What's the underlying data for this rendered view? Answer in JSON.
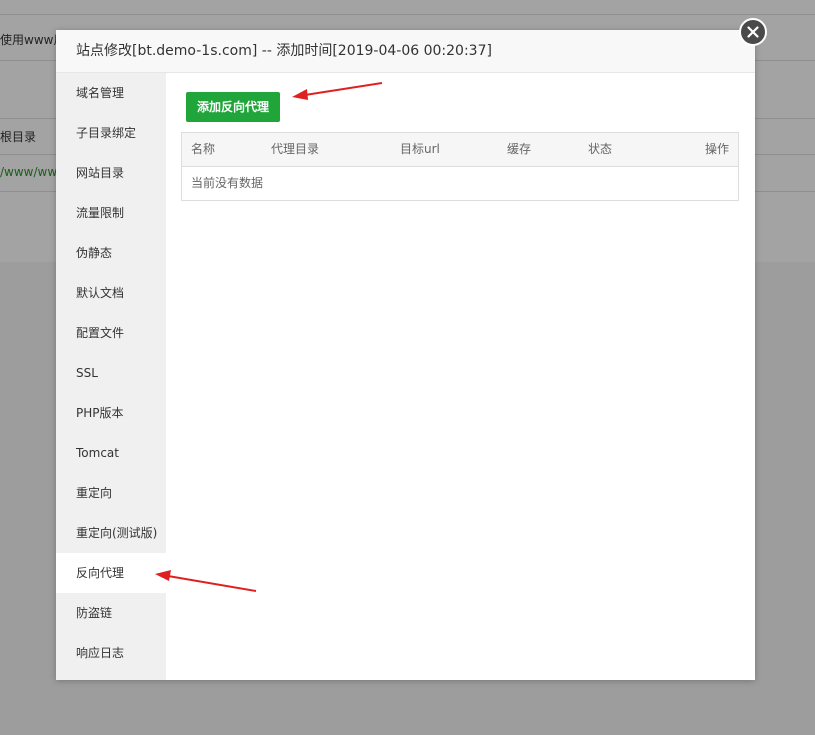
{
  "background": {
    "row1_text": "使用www用",
    "row2_text": "根目录",
    "row3_text": "/www/www"
  },
  "dialog": {
    "title": "站点修改[bt.demo-1s.com] -- 添加时间[2019-04-06 00:20:37]",
    "close_icon": "close-icon"
  },
  "sidebar": {
    "items": [
      {
        "label": "域名管理"
      },
      {
        "label": "子目录绑定"
      },
      {
        "label": "网站目录"
      },
      {
        "label": "流量限制"
      },
      {
        "label": "伪静态"
      },
      {
        "label": "默认文档"
      },
      {
        "label": "配置文件"
      },
      {
        "label": "SSL"
      },
      {
        "label": "PHP版本"
      },
      {
        "label": "Tomcat"
      },
      {
        "label": "重定向"
      },
      {
        "label": "重定向(测试版)"
      },
      {
        "label": "反向代理",
        "active": true
      },
      {
        "label": "防盗链"
      },
      {
        "label": "响应日志"
      }
    ]
  },
  "content": {
    "add_button": "添加反向代理",
    "table": {
      "headers": [
        "名称",
        "代理目录",
        "目标url",
        "缓存",
        "状态",
        "操作"
      ],
      "empty_text": "当前没有数据"
    }
  },
  "colors": {
    "accent": "#20a53a",
    "annotation_arrow": "#e02020"
  }
}
